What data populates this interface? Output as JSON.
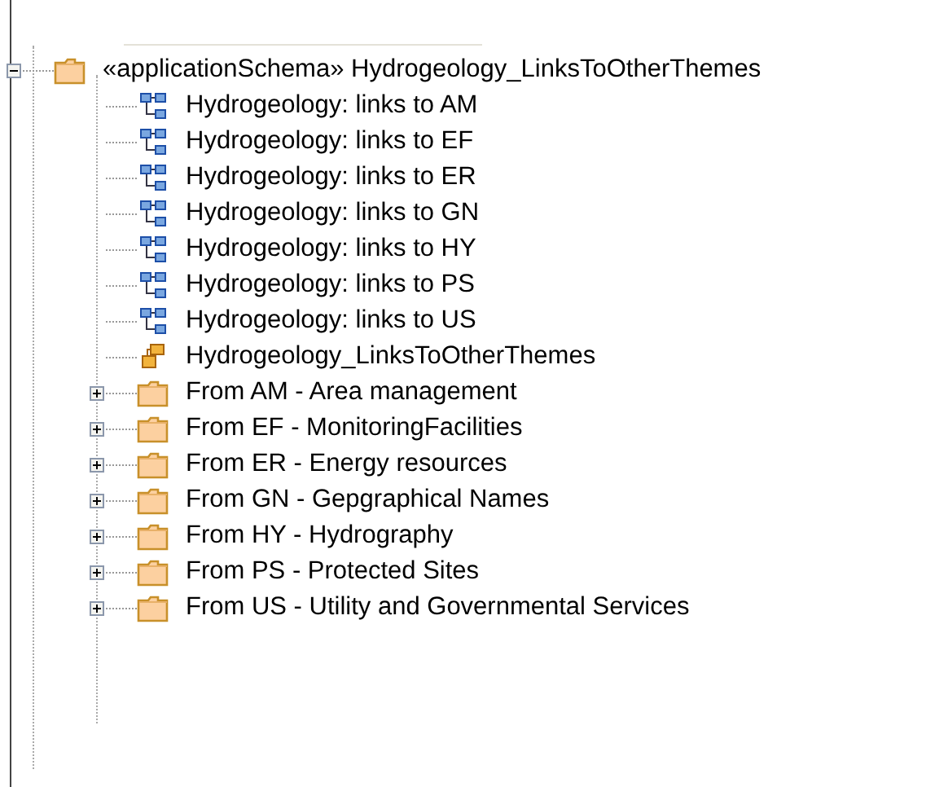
{
  "tree": [
    {
      "label": "«applicationSchema» Hydrogeology_LinksToOtherThemes",
      "kind": "folder",
      "expanded": true,
      "children": [
        {
          "label": "Hydrogeology: links to AM",
          "kind": "diagram"
        },
        {
          "label": "Hydrogeology: links to EF",
          "kind": "diagram"
        },
        {
          "label": "Hydrogeology: links to ER",
          "kind": "diagram"
        },
        {
          "label": "Hydrogeology: links to GN",
          "kind": "diagram"
        },
        {
          "label": "Hydrogeology: links to HY",
          "kind": "diagram"
        },
        {
          "label": "Hydrogeology: links to PS",
          "kind": "diagram"
        },
        {
          "label": "Hydrogeology: links to US",
          "kind": "diagram"
        },
        {
          "label": "Hydrogeology_LinksToOtherThemes",
          "kind": "class"
        },
        {
          "label": "From AM - Area management",
          "kind": "folder",
          "expanded": false
        },
        {
          "label": "From EF - MonitoringFacilities",
          "kind": "folder",
          "expanded": false
        },
        {
          "label": "From ER - Energy resources",
          "kind": "folder",
          "expanded": false
        },
        {
          "label": "From GN - Gepgraphical Names",
          "kind": "folder",
          "expanded": false
        },
        {
          "label": "From HY - Hydrography",
          "kind": "folder",
          "expanded": false
        },
        {
          "label": "From PS - Protected Sites",
          "kind": "folder",
          "expanded": false
        },
        {
          "label": "From US - Utility and Governmental Services",
          "kind": "folder",
          "expanded": false
        }
      ]
    }
  ]
}
